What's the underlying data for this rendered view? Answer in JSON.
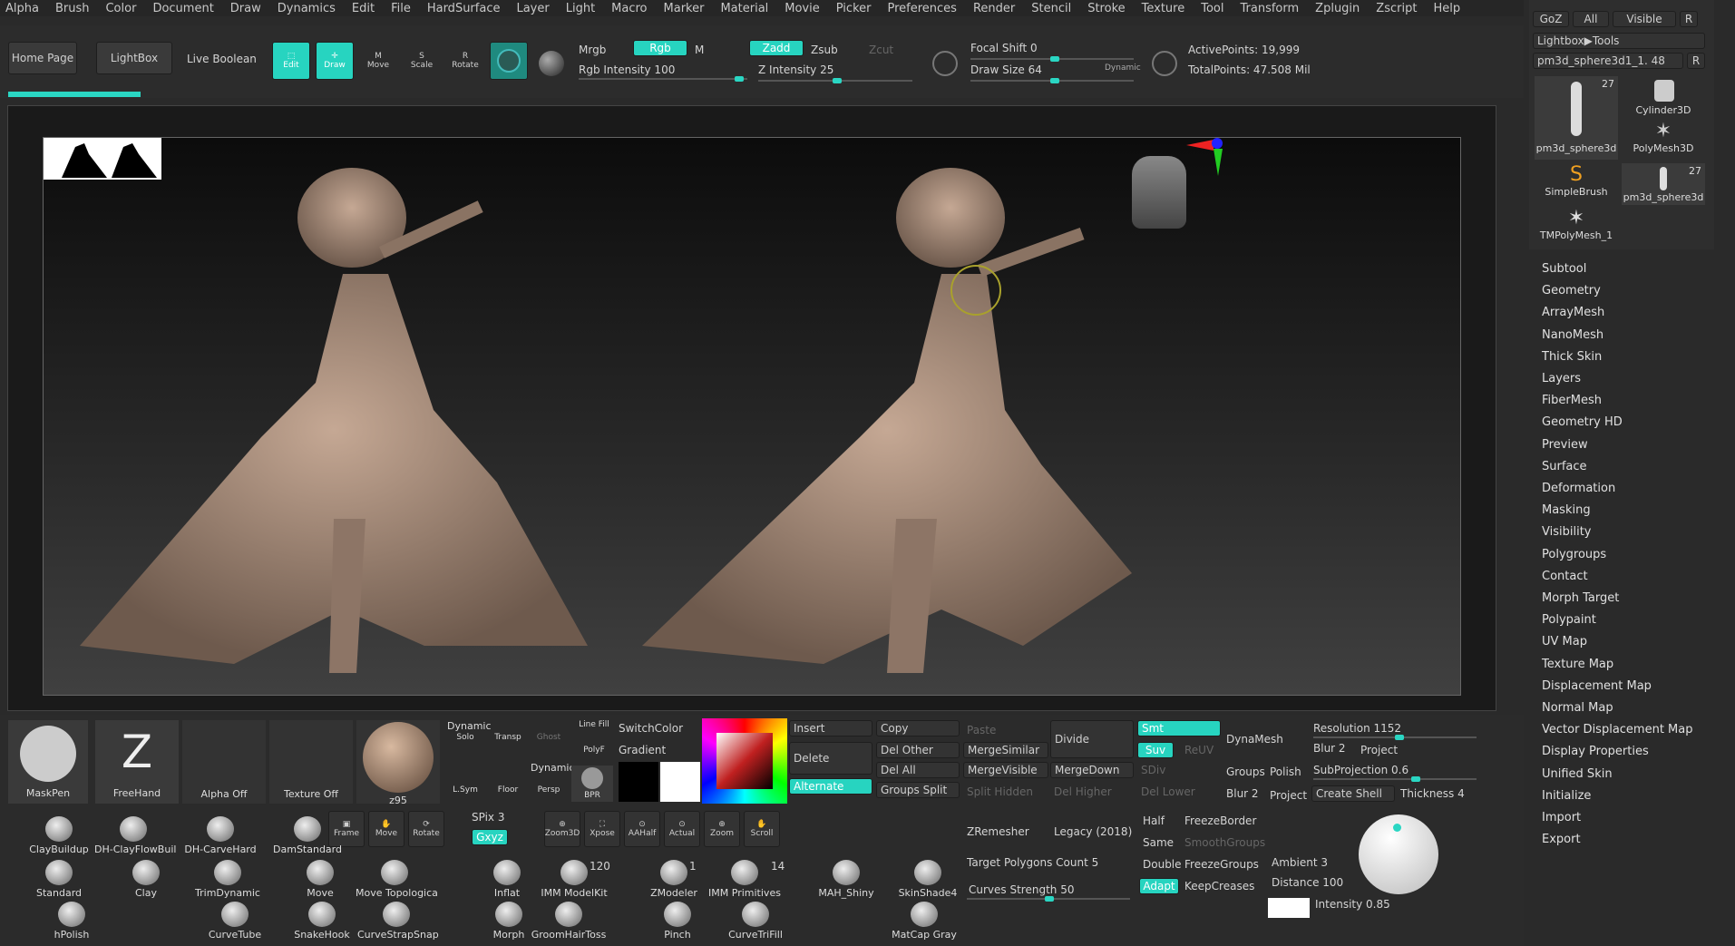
{
  "menu": [
    "Alpha",
    "Brush",
    "Color",
    "Document",
    "Draw",
    "Dynamics",
    "Edit",
    "File",
    "HardSurface",
    "Layer",
    "Light",
    "Macro",
    "Marker",
    "Material",
    "Movie",
    "Picker",
    "Preferences",
    "Render",
    "Stencil",
    "Stroke",
    "Texture",
    "Tool",
    "Transform",
    "Zplugin",
    "Zscript",
    "Help"
  ],
  "top": {
    "home": "Home Page",
    "lightbox": "LightBox",
    "live": "Live Boolean",
    "edit": "Edit",
    "draw": "Draw",
    "move": "Move",
    "scale": "Scale",
    "rotate": "Rotate",
    "mrgb": "Mrgb",
    "rgb": "Rgb",
    "m": "M",
    "rgbint": "Rgb Intensity 100",
    "zadd": "Zadd",
    "zsub": "Zsub",
    "zcut": "Zcut",
    "zint": "Z Intensity 25",
    "focal": "Focal Shift 0",
    "drawsize": "Draw Size 64",
    "dynamic": "Dynamic",
    "active": "ActivePoints: 19,999",
    "total": "TotalPoints: 47.508 Mil"
  },
  "tools": {
    "goz": "GoZ",
    "all": "All",
    "visible": "Visible",
    "r": "R",
    "lightbox": "Lightbox▶Tools",
    "current": "pm3d_sphere3d1_1. 48",
    "count27a": "27",
    "count27b": "27",
    "items": [
      "pm3d_sphere3d",
      "Cylinder3D",
      "SimpleBrush",
      "PolyMesh3D",
      "pm3d_sphere3d",
      "TMPolyMesh_1"
    ]
  },
  "right": [
    "Subtool",
    "Geometry",
    "ArrayMesh",
    "NanoMesh",
    "Thick Skin",
    "Layers",
    "FiberMesh",
    "Geometry HD",
    "Preview",
    "Surface",
    "Deformation",
    "Masking",
    "Visibility",
    "Polygroups",
    "Contact",
    "Morph Target",
    "Polypaint",
    "UV Map",
    "Texture Map",
    "Displacement Map",
    "Normal Map",
    "Vector Displacement Map",
    "Display Properties",
    "Unified Skin",
    "Initialize",
    "Import",
    "Export"
  ],
  "shelf": {
    "maskpen": "MaskPen",
    "freehand": "FreeHand",
    "alpha": "Alpha Off",
    "texture": "Texture Off",
    "mat": "z95",
    "solo": "Solo",
    "transp": "Transp",
    "ghost": "Ghost",
    "linefill": "Line Fill",
    "polyf": "PolyF",
    "lsym": "L.Sym",
    "floor": "Floor",
    "persp": "Persp",
    "bpr": "BPR",
    "switch": "SwitchColor",
    "gradient": "Gradient",
    "dyn1": "Dynamic",
    "dyn2": "Dynamic",
    "frame": "Frame",
    "move": "Move",
    "rotate": "Rotate",
    "spix": "SPix 3",
    "xyz": "Gxyz",
    "zoom3d": "Zoom3D",
    "xpose": "Xpose",
    "aahalf": "AAHalf",
    "actual": "Actual",
    "zoom": "Zoom",
    "scroll": "Scroll"
  },
  "brushes": [
    "ClayBuildup",
    "DH-ClayFlowBuil",
    "DH-CarveHard",
    "DamStandard",
    "Standard",
    "Clay",
    "TrimDynamic",
    "Move",
    "Move Topologica",
    "Inflat",
    "IMM ModelKit",
    "ZModeler",
    "IMM Primitives",
    "MAH_Shiny",
    "SkinShade4",
    "hPolish",
    "CurveTube",
    "SnakeHook",
    "CurveStrapSnap",
    "Morph",
    "GroomHairToss",
    "Pinch",
    "CurveTriFill",
    "MatCap Gray"
  ],
  "counts": {
    "imm": "120",
    "zmod": "1",
    "prim": "14"
  },
  "geo": {
    "insert": "Insert",
    "copy": "Copy",
    "paste": "Paste",
    "delete": "Delete",
    "delother": "Del Other",
    "mergesimilar": "MergeSimilar",
    "delall": "Del All",
    "mergevisible": "MergeVisible",
    "mergedown": "MergeDown",
    "alternate": "Alternate",
    "groupssplit": "Groups Split",
    "splithidden": "Split Hidden",
    "delhigher": "Del Higher",
    "dellower": "Del Lower",
    "divide": "Divide",
    "smt": "Smt",
    "suv": "Suv",
    "reuv": "ReUV",
    "sdiv": "SDiv",
    "zremesher": "ZRemesher",
    "legacy": "Legacy (2018)",
    "half": "Half",
    "same": "Same",
    "double": "Double",
    "adapt": "Adapt",
    "freezeborder": "FreezeBorder",
    "smoothgroups": "SmoothGroups",
    "freezegroups": "FreezeGroups",
    "keepcreases": "KeepCreases",
    "target": "Target Polygons Count 5",
    "curves": "Curves Strength 50",
    "dynamesh": "DynaMesh",
    "groups": "Groups",
    "polish": "Polish",
    "blur": "Blur 2",
    "project": "Project",
    "resolution": "Resolution 1152",
    "blur2": "Blur 2",
    "project2": "Project",
    "subprojection": "SubProjection 0.6",
    "createshell": "Create Shell",
    "thickness": "Thickness 4",
    "ambient": "Ambient 3",
    "distance": "Distance 100",
    "intensity": "Intensity 0.85"
  },
  "colors": {
    "accent": "#2ad6c3",
    "bg": "#282828",
    "panel": "#333333"
  }
}
